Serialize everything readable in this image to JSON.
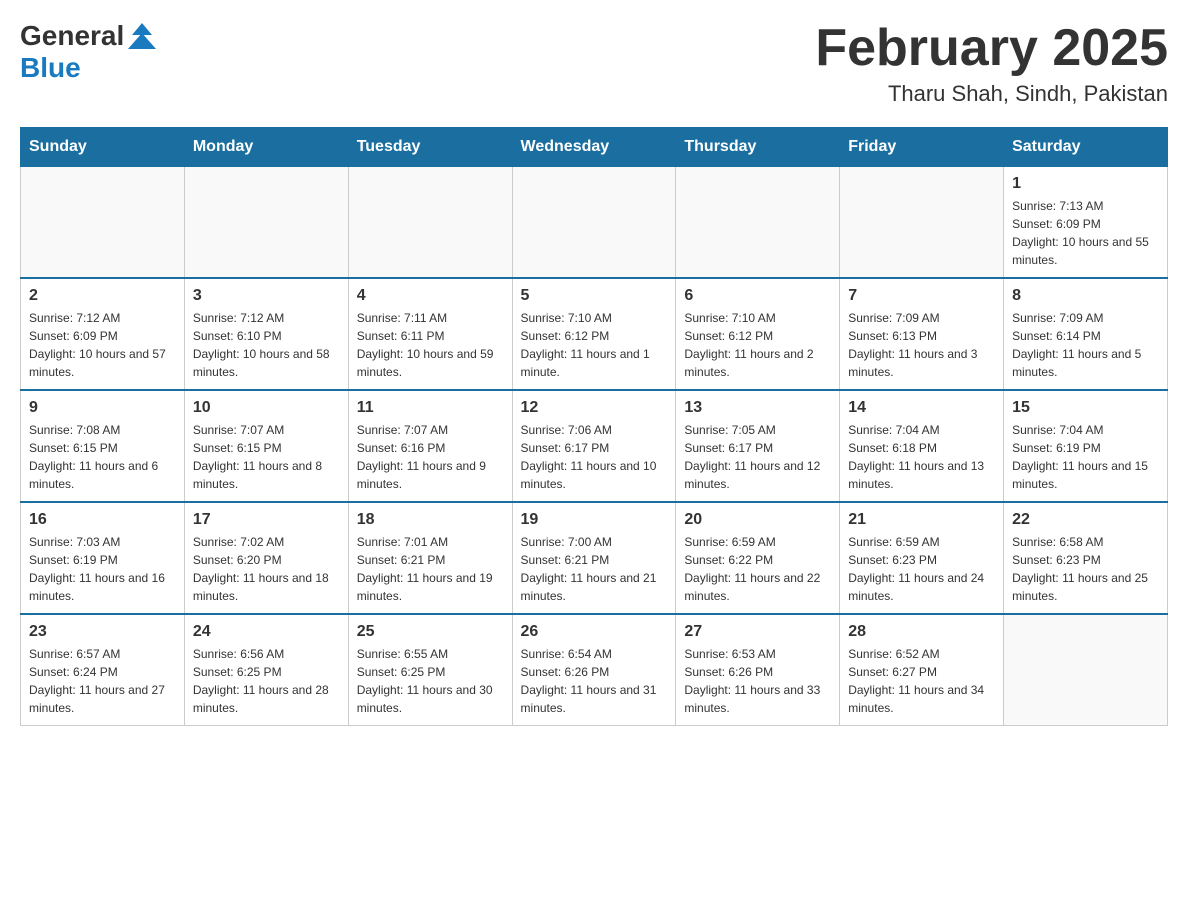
{
  "header": {
    "logo_general": "General",
    "logo_blue": "Blue",
    "month_title": "February 2025",
    "location": "Tharu Shah, Sindh, Pakistan"
  },
  "days_of_week": [
    "Sunday",
    "Monday",
    "Tuesday",
    "Wednesday",
    "Thursday",
    "Friday",
    "Saturday"
  ],
  "weeks": [
    [
      {
        "day": "",
        "sunrise": "",
        "sunset": "",
        "daylight": ""
      },
      {
        "day": "",
        "sunrise": "",
        "sunset": "",
        "daylight": ""
      },
      {
        "day": "",
        "sunrise": "",
        "sunset": "",
        "daylight": ""
      },
      {
        "day": "",
        "sunrise": "",
        "sunset": "",
        "daylight": ""
      },
      {
        "day": "",
        "sunrise": "",
        "sunset": "",
        "daylight": ""
      },
      {
        "day": "",
        "sunrise": "",
        "sunset": "",
        "daylight": ""
      },
      {
        "day": "1",
        "sunrise": "Sunrise: 7:13 AM",
        "sunset": "Sunset: 6:09 PM",
        "daylight": "Daylight: 10 hours and 55 minutes."
      }
    ],
    [
      {
        "day": "2",
        "sunrise": "Sunrise: 7:12 AM",
        "sunset": "Sunset: 6:09 PM",
        "daylight": "Daylight: 10 hours and 57 minutes."
      },
      {
        "day": "3",
        "sunrise": "Sunrise: 7:12 AM",
        "sunset": "Sunset: 6:10 PM",
        "daylight": "Daylight: 10 hours and 58 minutes."
      },
      {
        "day": "4",
        "sunrise": "Sunrise: 7:11 AM",
        "sunset": "Sunset: 6:11 PM",
        "daylight": "Daylight: 10 hours and 59 minutes."
      },
      {
        "day": "5",
        "sunrise": "Sunrise: 7:10 AM",
        "sunset": "Sunset: 6:12 PM",
        "daylight": "Daylight: 11 hours and 1 minute."
      },
      {
        "day": "6",
        "sunrise": "Sunrise: 7:10 AM",
        "sunset": "Sunset: 6:12 PM",
        "daylight": "Daylight: 11 hours and 2 minutes."
      },
      {
        "day": "7",
        "sunrise": "Sunrise: 7:09 AM",
        "sunset": "Sunset: 6:13 PM",
        "daylight": "Daylight: 11 hours and 3 minutes."
      },
      {
        "day": "8",
        "sunrise": "Sunrise: 7:09 AM",
        "sunset": "Sunset: 6:14 PM",
        "daylight": "Daylight: 11 hours and 5 minutes."
      }
    ],
    [
      {
        "day": "9",
        "sunrise": "Sunrise: 7:08 AM",
        "sunset": "Sunset: 6:15 PM",
        "daylight": "Daylight: 11 hours and 6 minutes."
      },
      {
        "day": "10",
        "sunrise": "Sunrise: 7:07 AM",
        "sunset": "Sunset: 6:15 PM",
        "daylight": "Daylight: 11 hours and 8 minutes."
      },
      {
        "day": "11",
        "sunrise": "Sunrise: 7:07 AM",
        "sunset": "Sunset: 6:16 PM",
        "daylight": "Daylight: 11 hours and 9 minutes."
      },
      {
        "day": "12",
        "sunrise": "Sunrise: 7:06 AM",
        "sunset": "Sunset: 6:17 PM",
        "daylight": "Daylight: 11 hours and 10 minutes."
      },
      {
        "day": "13",
        "sunrise": "Sunrise: 7:05 AM",
        "sunset": "Sunset: 6:17 PM",
        "daylight": "Daylight: 11 hours and 12 minutes."
      },
      {
        "day": "14",
        "sunrise": "Sunrise: 7:04 AM",
        "sunset": "Sunset: 6:18 PM",
        "daylight": "Daylight: 11 hours and 13 minutes."
      },
      {
        "day": "15",
        "sunrise": "Sunrise: 7:04 AM",
        "sunset": "Sunset: 6:19 PM",
        "daylight": "Daylight: 11 hours and 15 minutes."
      }
    ],
    [
      {
        "day": "16",
        "sunrise": "Sunrise: 7:03 AM",
        "sunset": "Sunset: 6:19 PM",
        "daylight": "Daylight: 11 hours and 16 minutes."
      },
      {
        "day": "17",
        "sunrise": "Sunrise: 7:02 AM",
        "sunset": "Sunset: 6:20 PM",
        "daylight": "Daylight: 11 hours and 18 minutes."
      },
      {
        "day": "18",
        "sunrise": "Sunrise: 7:01 AM",
        "sunset": "Sunset: 6:21 PM",
        "daylight": "Daylight: 11 hours and 19 minutes."
      },
      {
        "day": "19",
        "sunrise": "Sunrise: 7:00 AM",
        "sunset": "Sunset: 6:21 PM",
        "daylight": "Daylight: 11 hours and 21 minutes."
      },
      {
        "day": "20",
        "sunrise": "Sunrise: 6:59 AM",
        "sunset": "Sunset: 6:22 PM",
        "daylight": "Daylight: 11 hours and 22 minutes."
      },
      {
        "day": "21",
        "sunrise": "Sunrise: 6:59 AM",
        "sunset": "Sunset: 6:23 PM",
        "daylight": "Daylight: 11 hours and 24 minutes."
      },
      {
        "day": "22",
        "sunrise": "Sunrise: 6:58 AM",
        "sunset": "Sunset: 6:23 PM",
        "daylight": "Daylight: 11 hours and 25 minutes."
      }
    ],
    [
      {
        "day": "23",
        "sunrise": "Sunrise: 6:57 AM",
        "sunset": "Sunset: 6:24 PM",
        "daylight": "Daylight: 11 hours and 27 minutes."
      },
      {
        "day": "24",
        "sunrise": "Sunrise: 6:56 AM",
        "sunset": "Sunset: 6:25 PM",
        "daylight": "Daylight: 11 hours and 28 minutes."
      },
      {
        "day": "25",
        "sunrise": "Sunrise: 6:55 AM",
        "sunset": "Sunset: 6:25 PM",
        "daylight": "Daylight: 11 hours and 30 minutes."
      },
      {
        "day": "26",
        "sunrise": "Sunrise: 6:54 AM",
        "sunset": "Sunset: 6:26 PM",
        "daylight": "Daylight: 11 hours and 31 minutes."
      },
      {
        "day": "27",
        "sunrise": "Sunrise: 6:53 AM",
        "sunset": "Sunset: 6:26 PM",
        "daylight": "Daylight: 11 hours and 33 minutes."
      },
      {
        "day": "28",
        "sunrise": "Sunrise: 6:52 AM",
        "sunset": "Sunset: 6:27 PM",
        "daylight": "Daylight: 11 hours and 34 minutes."
      },
      {
        "day": "",
        "sunrise": "",
        "sunset": "",
        "daylight": ""
      }
    ]
  ]
}
